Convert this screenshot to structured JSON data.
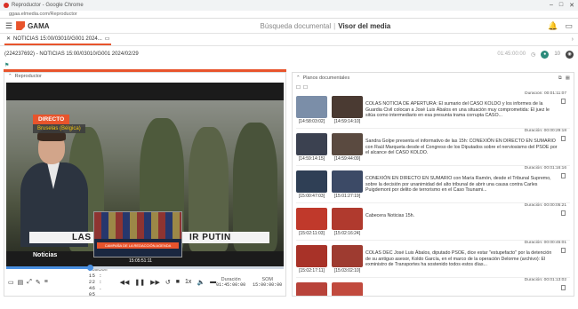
{
  "browser": {
    "window_title": "Reproductor - Google Chrome",
    "url": "ggaa.elmedia.com/Reproductor"
  },
  "app": {
    "name": "GAMA",
    "breadcrumb": [
      "Búsqueda documental",
      "Visor del media"
    ]
  },
  "tab": {
    "label": "NOTICIAS 15:00/03010/G001 2024..."
  },
  "info": {
    "title": "(224237692) - NOTICIAS 15:00/03010/G001 2024/02/29",
    "duration": "01:45:00:00",
    "count": "10"
  },
  "left_panel": {
    "title": "Reproductor"
  },
  "video": {
    "badge": "DIRECTO",
    "location": "Bruselas (Bélgica)",
    "lower_third_left": "LAS",
    "lower_third_right": "IR PUTIN",
    "pip_caption": "CAMPAÑA DE LA REDACCIÓN AGENDA",
    "channel_logo": "Noticias",
    "overlay_timecode": "15:05:51:11"
  },
  "player": {
    "progress": 0.3,
    "position_label": "Posición",
    "position_value": "15 : 22 : 46 . 05",
    "speed": "1x",
    "duration_label": "Duración",
    "duration_value": "01:45:00:00",
    "som_label": "SOM",
    "som_value": "15:00:00:00"
  },
  "right_panel": {
    "title": "Planos documentales"
  },
  "docs": [
    {
      "duration": "Duración: 00:01:11:07",
      "thumbs": [
        {
          "tc": "[14:58:03:02]",
          "color": "#7b8ea8"
        },
        {
          "tc": "[14:59:14:10]",
          "color": "#4a3a32"
        }
      ],
      "text": "COLAS NOTICIA DE APERTURA: El sumario del CASO KOLDO y los informes de la Guardia Civil colocan a José Luis Ábalos en una situación muy comprometida: El juez le sitúa como intermediario en esa presunta trama corrupta CASO..."
    },
    {
      "duration": "Duración: 00:00:29:18",
      "thumbs": [
        {
          "tc": "[14:59:14:15]",
          "color": "#3b4150"
        },
        {
          "tc": "[14:59:44:09]",
          "color": "#5a4a40"
        }
      ],
      "text": "Sandra Golpe presenta el informativo de las 15h: CONEXIÓN EN DIRECTO EN SUMARIO con Raúl Marqueta desde el Congreso de los Diputados sobre el nerviosismo del PSOE por el alcance del CASO KOLDO."
    },
    {
      "duration": "Duración: 00:01:16:16",
      "thumbs": [
        {
          "tc": "[15:00:47:03]",
          "color": "#2f3f55"
        },
        {
          "tc": "[15:01:27:19]",
          "color": "#3c4a66"
        }
      ],
      "text": "CONEXIÓN EN DIRECTO EN SUMARIO con María Ramón, desde el Tribunal Supremo, sobre la decisión por unanimidad del alto tribunal de abrir una causa contra Carles Puigdemont por delito de terrorismo en el Caso Tsunami..."
    },
    {
      "duration": "Duración: 00:00:05:21",
      "thumbs": [
        {
          "tc": "[15:02:11:03]",
          "color": "#c0392b"
        },
        {
          "tc": "[15:02:16:24]",
          "color": "#b03a2e"
        }
      ],
      "text": "Cabecera Noticias 15h."
    },
    {
      "duration": "Duración: 00:00:45:01",
      "thumbs": [
        {
          "tc": "[15:02:17:11]",
          "color": "#a83228"
        },
        {
          "tc": "[15:03:02:10]",
          "color": "#9e3b30"
        }
      ],
      "text": "COLAS DEC José Luis Ábalos, diputado PSOE, dice estar \"estupefacto\" por la detención de su antiguo asesor, Koldo García, en el marco de la operación Delorme (archivo): El exministro de Transportes ha sostenido todos estos días..."
    },
    {
      "duration": "Duración: 00:01:13:02",
      "thumbs": [
        {
          "tc": "",
          "color": "#b8433a"
        },
        {
          "tc": "",
          "color": "#c14a3e"
        }
      ],
      "text": ""
    }
  ]
}
